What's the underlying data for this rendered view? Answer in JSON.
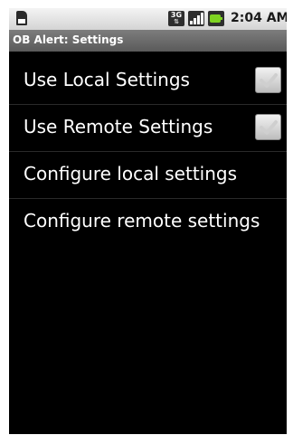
{
  "status_bar": {
    "network_label": "3G",
    "time": "2:04 AM",
    "icons": [
      "sd-card-icon",
      "3g-data-icon",
      "signal-icon",
      "battery-charging-icon"
    ]
  },
  "title_bar": {
    "title": "OB Alert: Settings"
  },
  "settings": [
    {
      "label": "Use Local Settings",
      "has_checkbox": true,
      "checked": true
    },
    {
      "label": "Use Remote Settings",
      "has_checkbox": true,
      "checked": true
    },
    {
      "label": "Configure local settings",
      "has_checkbox": false
    },
    {
      "label": "Configure remote settings",
      "has_checkbox": false
    }
  ],
  "colors": {
    "background": "#000000",
    "title_bar": "#6b6b6b",
    "status_bar": "#e0e0e0",
    "battery": "#7ed321"
  }
}
